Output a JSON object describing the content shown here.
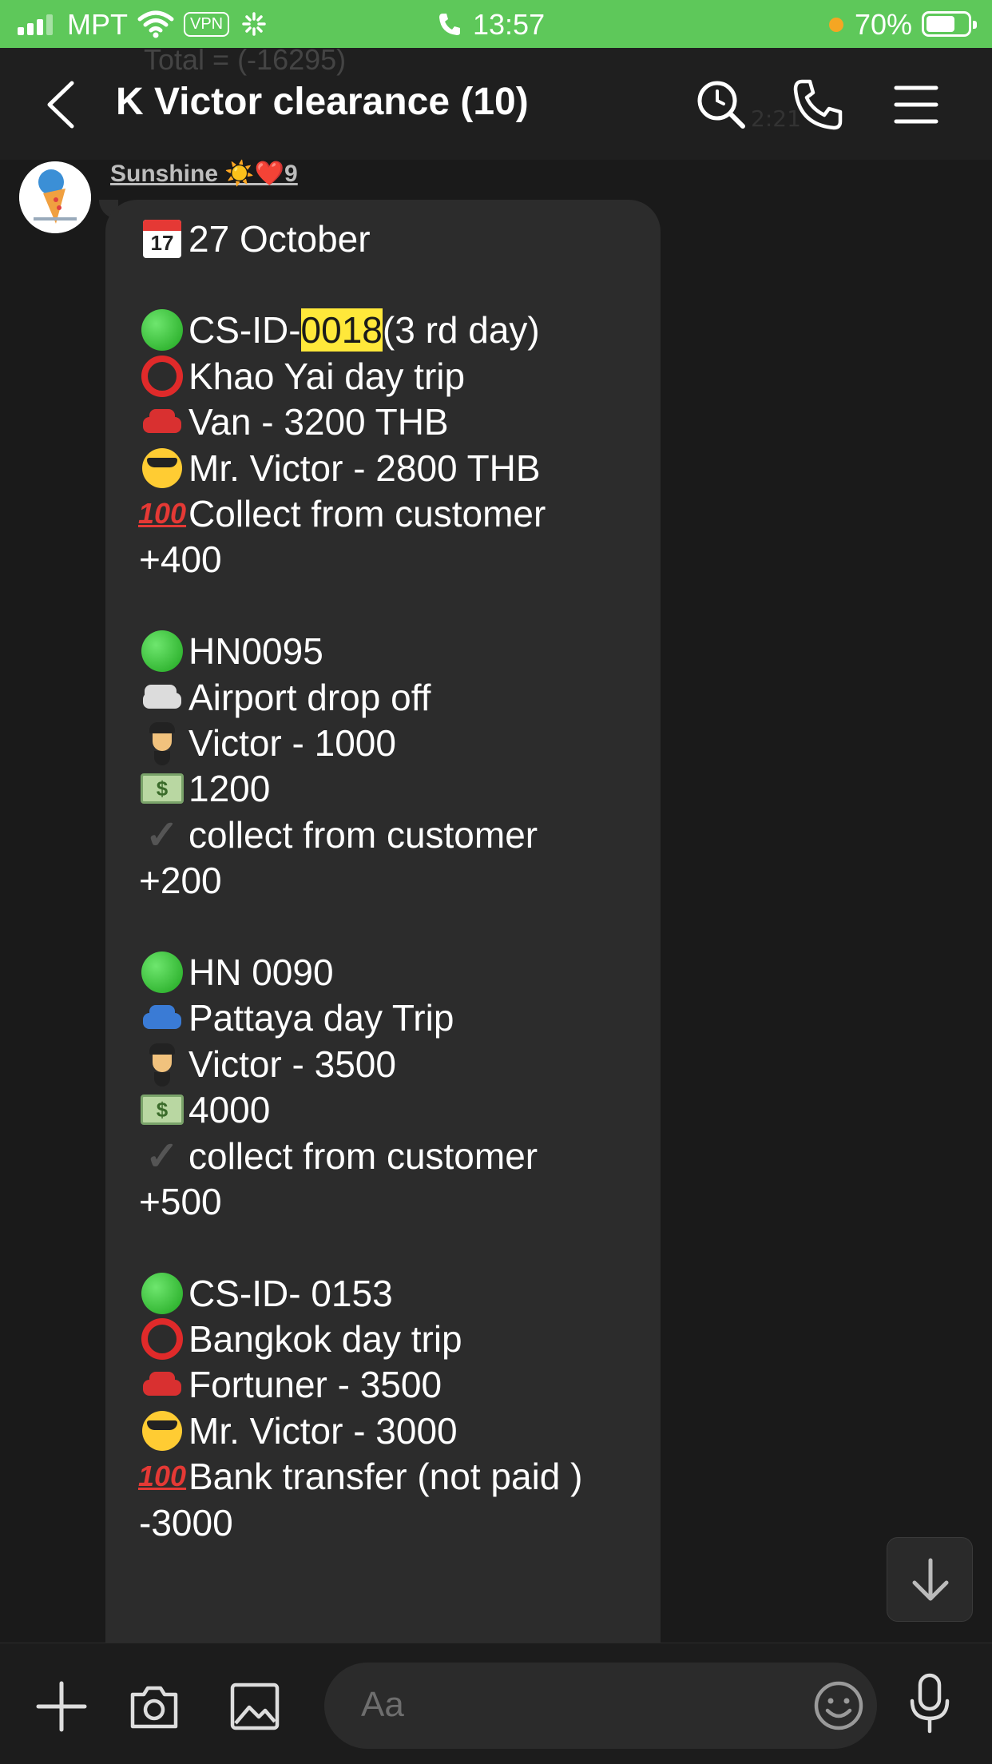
{
  "status_bar": {
    "carrier": "MPT",
    "vpn": "VPN",
    "time": "13:57",
    "battery": "70%"
  },
  "header": {
    "peek_text": "Total = (-16295)",
    "title": "K Victor clearance  (10)",
    "icons": [
      "back-chevron-icon",
      "search-icon",
      "phone-icon",
      "menu-icon"
    ]
  },
  "message": {
    "sender": "Sunshine ☀️❤️9",
    "lines": [
      {
        "emoji": "calendar",
        "text": "27 October"
      },
      {
        "emoji": "",
        "text": ""
      },
      {
        "emoji": "green-circle",
        "text_before": "CS-ID-",
        "highlight": "0018",
        "text_after": "(3 rd day)"
      },
      {
        "emoji": "red-ring",
        "text": "Khao Yai day trip"
      },
      {
        "emoji": "red-car",
        "text": "Van  -  3200 THB"
      },
      {
        "emoji": "sunglasses",
        "text": "Mr. Victor   -  2800 THB"
      },
      {
        "emoji": "hundred",
        "text": "Collect from customer"
      },
      {
        "emoji": "",
        "text": "+400"
      },
      {
        "emoji": "",
        "text": ""
      },
      {
        "emoji": "green-circle",
        "text": "HN0095"
      },
      {
        "emoji": "van",
        "text": "Airport drop off"
      },
      {
        "emoji": "pilot",
        "text": "Victor - 1000"
      },
      {
        "emoji": "money",
        "text": "1200"
      },
      {
        "emoji": "check",
        "text": "collect from customer"
      },
      {
        "emoji": "",
        "text": "+200"
      },
      {
        "emoji": "",
        "text": ""
      },
      {
        "emoji": "green-circle",
        "text": "HN 0090"
      },
      {
        "emoji": "blue-car",
        "text": "Pattaya day Trip"
      },
      {
        "emoji": "pilot",
        "text": "Victor - 3500"
      },
      {
        "emoji": "money",
        "text": "4000"
      },
      {
        "emoji": "check",
        "text": "collect from customer"
      },
      {
        "emoji": "",
        "text": "+500"
      },
      {
        "emoji": "",
        "text": ""
      },
      {
        "emoji": "green-circle",
        "text": "CS-ID- 0153"
      },
      {
        "emoji": "red-ring",
        "text": "Bangkok day trip"
      },
      {
        "emoji": "red-car",
        "text": "Fortuner - 3500"
      },
      {
        "emoji": "sunglasses",
        "text": "Mr. Victor - 3000"
      },
      {
        "emoji": "hundred",
        "text": "Bank transfer (not paid )"
      },
      {
        "emoji": "",
        "text": "-3000"
      }
    ]
  },
  "composer": {
    "placeholder": "Aa",
    "icons": [
      "plus-icon",
      "camera-icon",
      "image-icon",
      "emoji-icon",
      "microphone-icon"
    ]
  },
  "colors": {
    "status_bar_bg": "#5ec85a",
    "chat_bg": "#1a1a1a",
    "bubble_bg": "#2c2c2c",
    "highlight": "#ffe83a"
  }
}
